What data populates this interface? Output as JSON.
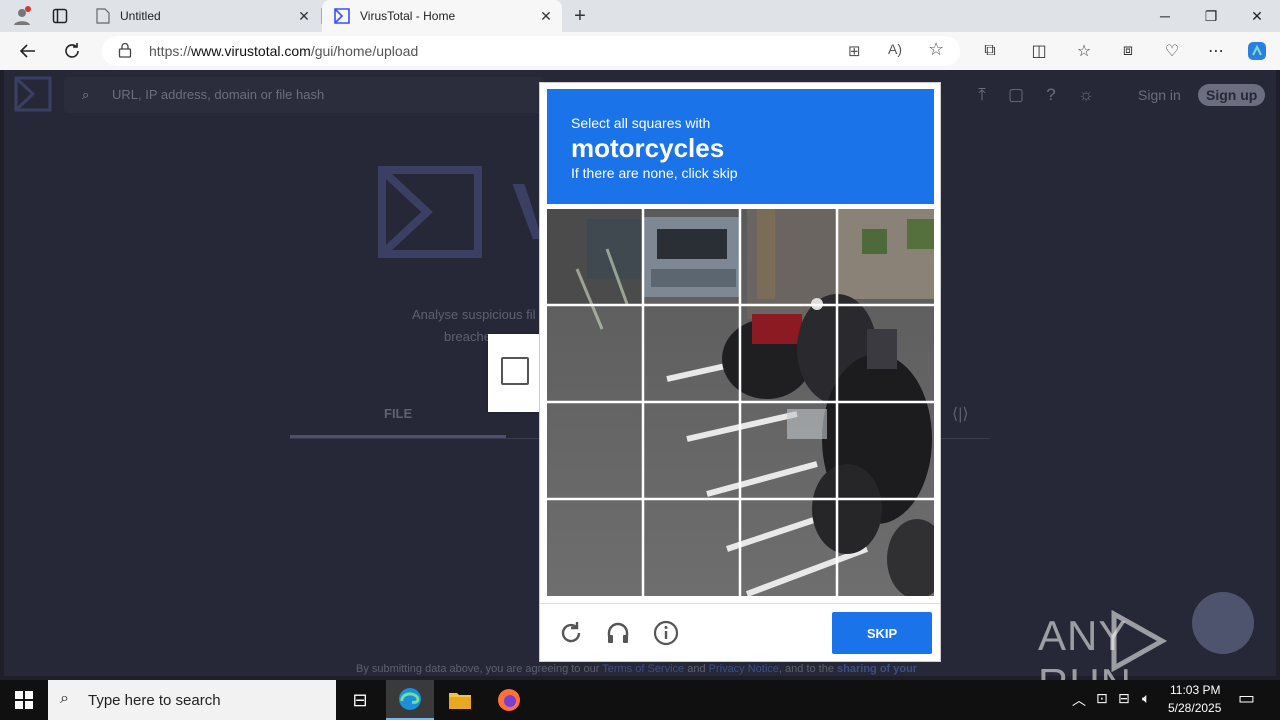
{
  "browser": {
    "tabs": [
      {
        "title": "Untitled"
      },
      {
        "title": "VirusTotal - Home"
      }
    ],
    "url_prefix": "https://",
    "url_domain": "www.virustotal.com",
    "url_path": "/gui/home/upload"
  },
  "virustotal": {
    "search_placeholder": "URL, IP address, domain or file hash",
    "sign_in": "Sign in",
    "sign_up": "Sign up",
    "logo_word": "V",
    "description_line1": "Analyse suspicious fil",
    "description_line2": "breache",
    "tab_file": "FILE",
    "footer_prefix": "By submitting data above, you are agreeing to our ",
    "footer_terms": "Terms of Service",
    "footer_and": " and ",
    "footer_privacy": "Privacy Notice",
    "footer_suffix": ", and to the ",
    "footer_sharing": "sharing of your"
  },
  "captcha": {
    "instruction_line1": "Select all squares with",
    "instruction_target": "motorcycles",
    "instruction_line3": "If there are none, click skip",
    "skip_label": "SKIP",
    "icons": [
      "reload-icon",
      "audio-icon",
      "info-icon"
    ]
  },
  "watermark": {
    "left": "ANY",
    "right": "RUN"
  },
  "taskbar": {
    "search_placeholder": "Type here to search",
    "time": "11:03 PM",
    "date": "5/28/2025"
  },
  "colors": {
    "captcha_blue": "#1a73e8",
    "vt_background": "#262837"
  }
}
